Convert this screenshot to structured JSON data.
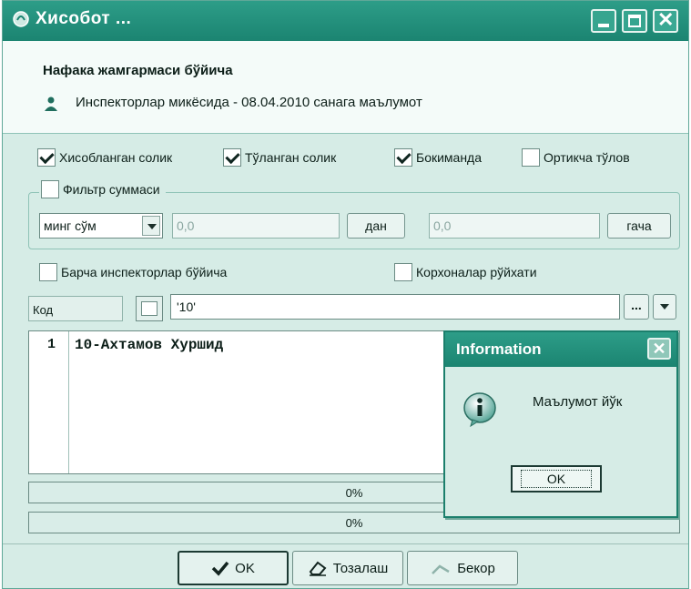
{
  "window": {
    "title": "Хисобот ...",
    "header_title": "Нафака жамгармаси бўйича",
    "header_subtitle": "Инспекторлар микёсида - 08.04.2010 санага маълумот"
  },
  "checkboxes": [
    {
      "label": "Хисобланган солик",
      "checked": true
    },
    {
      "label": "Тўланган солик",
      "checked": true
    },
    {
      "label": "Бокиманда",
      "checked": true
    },
    {
      "label": "Ортикча тўлов",
      "checked": false
    }
  ],
  "filter": {
    "label": "Фильтр суммаси",
    "checked": false,
    "unit": "минг сўм",
    "from_value": "0,0",
    "from_button": "дан",
    "to_value": "0,0",
    "to_button": "гача"
  },
  "options": {
    "all_inspectors": "Барча инспекторлар бўйича",
    "company_list": "Корхоналар рўйхати"
  },
  "code": {
    "label": "Код",
    "value": "'10'",
    "more_button": "..."
  },
  "memo": {
    "line_number": "1",
    "line_text": "10-Ахтамов Хуршид"
  },
  "progress": [
    {
      "text": "0%",
      "value": 0
    },
    {
      "text": "0%",
      "value": 0
    }
  ],
  "footer": {
    "ok": "OK",
    "clear": "Тозалаш",
    "cancel": "Бекор"
  },
  "dialog": {
    "title": "Information",
    "message": "Маълумот йўк",
    "ok": "OK"
  },
  "colors": {
    "titlebar": "#1b8471",
    "window_bg": "#d6ece6",
    "header_bg": "#f4fbf9"
  }
}
